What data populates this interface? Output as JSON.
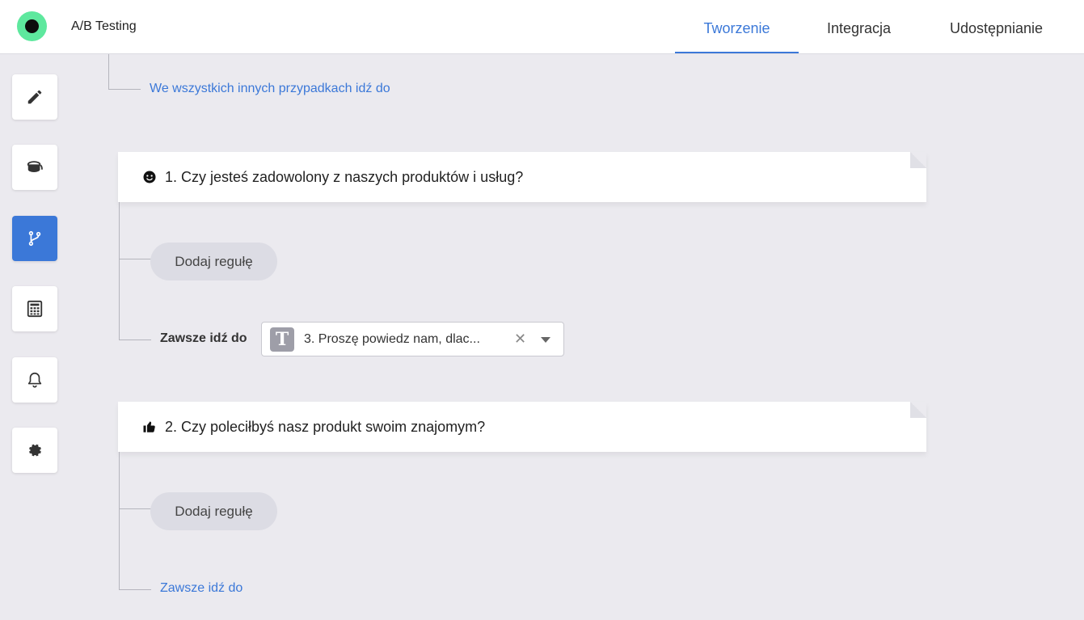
{
  "header": {
    "app_title": "A/B Testing",
    "tabs": [
      {
        "label": "Tworzenie",
        "active": true
      },
      {
        "label": "Integracja",
        "active": false
      },
      {
        "label": "Udostępnianie",
        "active": false
      }
    ]
  },
  "sidebar": {
    "items": [
      {
        "icon": "pencil-icon"
      },
      {
        "icon": "paint-bucket-icon"
      },
      {
        "icon": "branch-icon",
        "active": true
      },
      {
        "icon": "calculator-icon"
      },
      {
        "icon": "bell-icon"
      },
      {
        "icon": "gear-icon"
      }
    ]
  },
  "logic": {
    "otherwise_link": "We wszystkich innych przypadkach idź do",
    "questions": [
      {
        "icon": "smiley-icon",
        "title": "1. Czy jesteś zadowolony z naszych produktów i usług?",
        "add_rule": "Dodaj regułę",
        "always_label": "Zawsze idź do",
        "always_target": "3. Proszę powiedz nam, dlac..."
      },
      {
        "icon": "thumbs-up-icon",
        "title": "2. Czy poleciłbyś nasz produkt swoim znajomym?",
        "add_rule": "Dodaj regułę",
        "always_link": "Zawsze idź do"
      }
    ]
  },
  "colors": {
    "accent": "#3b78d8",
    "logo_ring": "#5ee89e",
    "background": "#ebeaef"
  }
}
